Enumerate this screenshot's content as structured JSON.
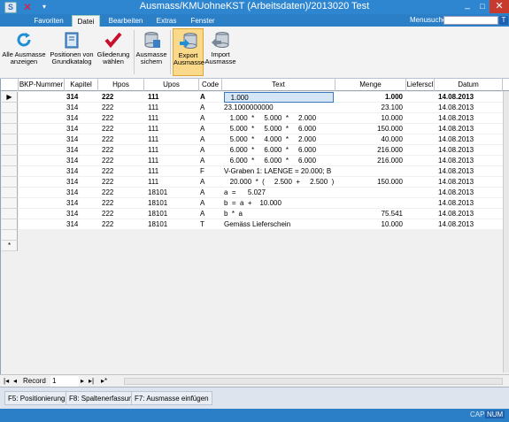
{
  "window": {
    "title": "Ausmass/KMUohneKST (Arbeitsdaten)/2013020 Test",
    "minimize": "_",
    "maximize": "□",
    "close": "✕",
    "app_icon": "app-icon",
    "quick_access": {
      "close_glyph": "✕",
      "dropdown_glyph": "▾"
    }
  },
  "tabs": [
    {
      "label": "Favoriten",
      "active": false
    },
    {
      "label": "Datei",
      "active": true
    },
    {
      "label": "Bearbeiten",
      "active": false
    },
    {
      "label": "Extras",
      "active": false
    },
    {
      "label": "Fenster",
      "active": false
    }
  ],
  "menusuche": {
    "label": "Menusuche",
    "value": "",
    "help": "T"
  },
  "ribbon": {
    "buttons": [
      {
        "line1": "Alle Ausmasse",
        "line2": "anzeigen",
        "icon": "refresh-icon"
      },
      {
        "line1": "Positionen von",
        "line2": "Grundkatalog",
        "icon": "book-icon"
      },
      {
        "line1": "Gliederung",
        "line2": "wählen",
        "icon": "checkmark-icon"
      },
      {
        "line1": "Ausmasse",
        "line2": "sichern",
        "icon": "save-database-icon"
      },
      {
        "line1": "Export",
        "line2": "Ausmasse",
        "icon": "export-database-icon",
        "active": true
      },
      {
        "line1": "Import",
        "line2": "Ausmasse",
        "icon": "import-database-icon"
      }
    ]
  },
  "grid": {
    "columns": [
      "BKP-Nummer",
      "Kapitel",
      "Hpos",
      "Upos",
      "Code",
      "Text",
      "Menge",
      "Lieferscl",
      "Datum"
    ],
    "rows": [
      {
        "kapitel": "314",
        "hpos": "222",
        "upos": "111",
        "code": "A",
        "text": "   1.000",
        "menge": "1.000",
        "datum": "14.08.2013",
        "bold": true,
        "current": true
      },
      {
        "kapitel": "314",
        "hpos": "222",
        "upos": "111",
        "code": "A",
        "text": "23.1000000000",
        "menge": "23.100",
        "datum": "14.08.2013"
      },
      {
        "kapitel": "314",
        "hpos": "222",
        "upos": "111",
        "code": "A",
        "text": "   1.000  *     5.000  *     2.000",
        "menge": "10.000",
        "datum": "14.08.2013"
      },
      {
        "kapitel": "314",
        "hpos": "222",
        "upos": "111",
        "code": "A",
        "text": "   5.000  *     5.000  *     6.000",
        "menge": "150.000",
        "datum": "14.08.2013"
      },
      {
        "kapitel": "314",
        "hpos": "222",
        "upos": "111",
        "code": "A",
        "text": "   5.000  *     4.000  *     2.000",
        "menge": "40.000",
        "datum": "14.08.2013"
      },
      {
        "kapitel": "314",
        "hpos": "222",
        "upos": "111",
        "code": "A",
        "text": "   6.000  *     6.000  *     6.000",
        "menge": "216.000",
        "datum": "14.08.2013"
      },
      {
        "kapitel": "314",
        "hpos": "222",
        "upos": "111",
        "code": "A",
        "text": "   6.000  *     6.000  *     6.000",
        "menge": "216.000",
        "datum": "14.08.2013"
      },
      {
        "kapitel": "314",
        "hpos": "222",
        "upos": "111",
        "code": "F",
        "text": "V-Graben 1: LAENGE = 20.000; B",
        "menge": "",
        "datum": "14.08.2013"
      },
      {
        "kapitel": "314",
        "hpos": "222",
        "upos": "111",
        "code": "A",
        "text": "   20.000  *  (     2.500  +     2.500  )",
        "menge": "150.000",
        "datum": "14.08.2013"
      },
      {
        "kapitel": "314",
        "hpos": "222",
        "upos": "18101",
        "code": "A",
        "text": "a  =      5.027",
        "menge": "",
        "datum": "14.08.2013"
      },
      {
        "kapitel": "314",
        "hpos": "222",
        "upos": "18101",
        "code": "A",
        "text": "b  =  a  +    10.000",
        "menge": "",
        "datum": "14.08.2013"
      },
      {
        "kapitel": "314",
        "hpos": "222",
        "upos": "18101",
        "code": "A",
        "text": "b  *  a",
        "menge": "75.541",
        "datum": "14.08.2013"
      },
      {
        "kapitel": "314",
        "hpos": "222",
        "upos": "18101",
        "code": "T",
        "text": "Gemäss Lieferschein",
        "menge": "10.000",
        "datum": "14.08.2013"
      }
    ],
    "new_row_marker": "*",
    "current_row_marker": "▶"
  },
  "navigator": {
    "record_label": "Record",
    "record_value": "1",
    "first": "|◂",
    "prev": "◂",
    "next": "▸",
    "last": "▸|",
    "new": "▸*"
  },
  "function_keys": [
    "F5: Positionierung",
    "F8: Spaltenerfassung",
    "F7: Ausmasse einfügen"
  ],
  "status": {
    "cap": "CAP",
    "num": "NUM"
  },
  "colors": {
    "accent": "#2b7fc7",
    "active_button": "#fad98a"
  }
}
